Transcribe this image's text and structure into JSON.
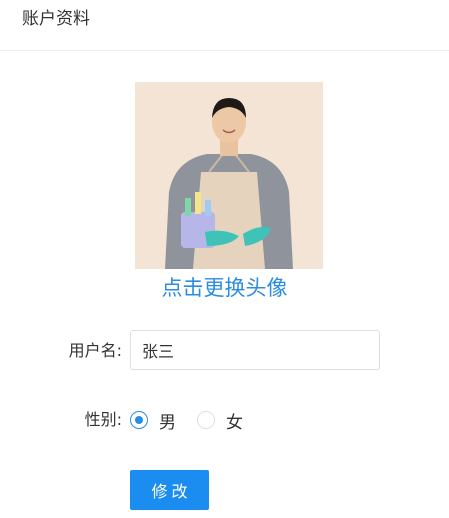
{
  "header": {
    "title": "账户资料"
  },
  "avatar": {
    "change_label": "点击更换头像"
  },
  "form": {
    "username_label": "用户名:",
    "username_value": "张三",
    "gender_label": "性别:",
    "gender_options": [
      {
        "label": "男",
        "checked": true
      },
      {
        "label": "女",
        "checked": false
      }
    ],
    "submit_label": "修改"
  },
  "colors": {
    "accent": "#2b8de0",
    "button": "#1b8cf0",
    "border": "#dcdfe6",
    "text": "#333333"
  },
  "icons": {
    "radio_checked": "radio-checked-icon",
    "radio_unchecked": "radio-unchecked-icon"
  }
}
